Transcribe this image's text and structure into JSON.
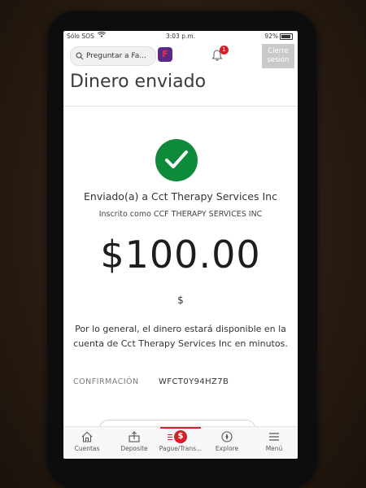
{
  "status_bar": {
    "carrier": "Sólo SOS",
    "time": "3:03 p.m.",
    "battery": "92%",
    "battery_level": 0.92
  },
  "header": {
    "search_placeholder": "Preguntar a Fa...",
    "logo_letter": "F",
    "notification_count": "1",
    "signout_label": "Cierre sesión"
  },
  "page": {
    "title": "Dinero enviado"
  },
  "confirmation": {
    "sent_to": "Enviado(a) a Cct Therapy Services Inc",
    "registered_as": "Inscrito como CCF THERAPY SERVICES INC",
    "amount": "$100.00",
    "currency": "$",
    "availability_note": "Por lo general, el dinero estará disponible en la cuenta de Cct Therapy Services Inc en minutos.",
    "confirmation_label": "CONFIRMACIÓN",
    "confirmation_code": "WFCT0Y94HZ7B"
  },
  "bottom_nav": {
    "items": [
      {
        "label": "Cuentas",
        "icon": "home-icon"
      },
      {
        "label": "Deposite",
        "icon": "deposit-icon"
      },
      {
        "label": "Pague/Trans...",
        "icon": "pay-transfer-icon",
        "active": true
      },
      {
        "label": "Explore",
        "icon": "compass-icon"
      },
      {
        "label": "Menú",
        "icon": "hamburger-menu-icon"
      }
    ]
  },
  "colors": {
    "brand_red": "#d71e28",
    "success_green": "#0e8a3b",
    "brand_purple": "#5b2a86"
  }
}
